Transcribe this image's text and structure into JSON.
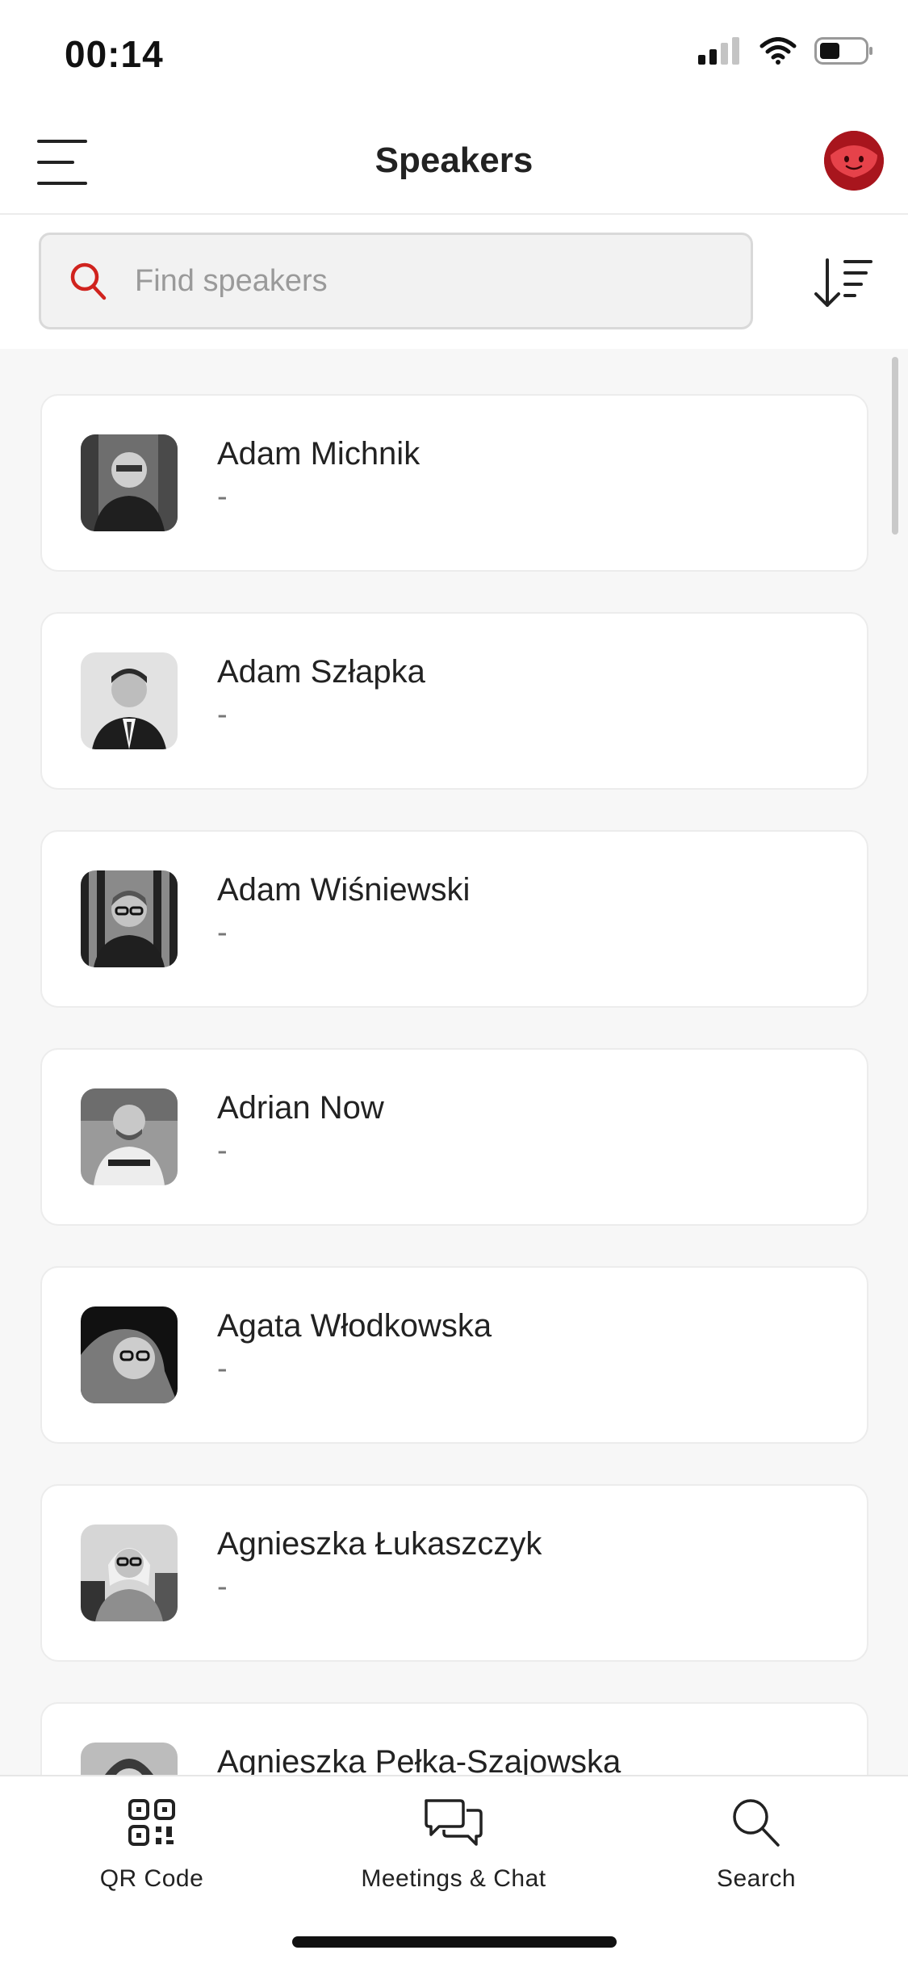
{
  "status_bar": {
    "time": "00:14",
    "icons": [
      "cellular-signal-icon",
      "wifi-icon",
      "battery-icon"
    ]
  },
  "header": {
    "title": "Speakers",
    "menu_icon": "hamburger-menu-icon",
    "avatar_icon": "user-avatar"
  },
  "search": {
    "placeholder": "Find speakers",
    "value": "",
    "icon": "search-icon",
    "sort_icon": "sort-descending-icon"
  },
  "speakers": [
    {
      "name": "Adam Michnik",
      "subtitle": "-"
    },
    {
      "name": "Adam Szłapka",
      "subtitle": "-"
    },
    {
      "name": "Adam Wiśniewski",
      "subtitle": "-"
    },
    {
      "name": "Adrian Now",
      "subtitle": "-"
    },
    {
      "name": "Agata Włodkowska",
      "subtitle": "-"
    },
    {
      "name": "Agnieszka Łukaszczyk",
      "subtitle": "-"
    },
    {
      "name": "Agnieszka Pełka-Szajowska",
      "subtitle": ""
    }
  ],
  "tab_bar": {
    "tabs": [
      {
        "label": "QR Code",
        "icon": "qr-code-icon"
      },
      {
        "label": "Meetings & Chat",
        "icon": "chat-bubbles-icon"
      },
      {
        "label": "Search",
        "icon": "search-icon"
      }
    ]
  },
  "colors": {
    "accent": "#d0231e",
    "avatar_bg": "#a8151d",
    "background": "#f7f7f7",
    "card": "#ffffff"
  }
}
